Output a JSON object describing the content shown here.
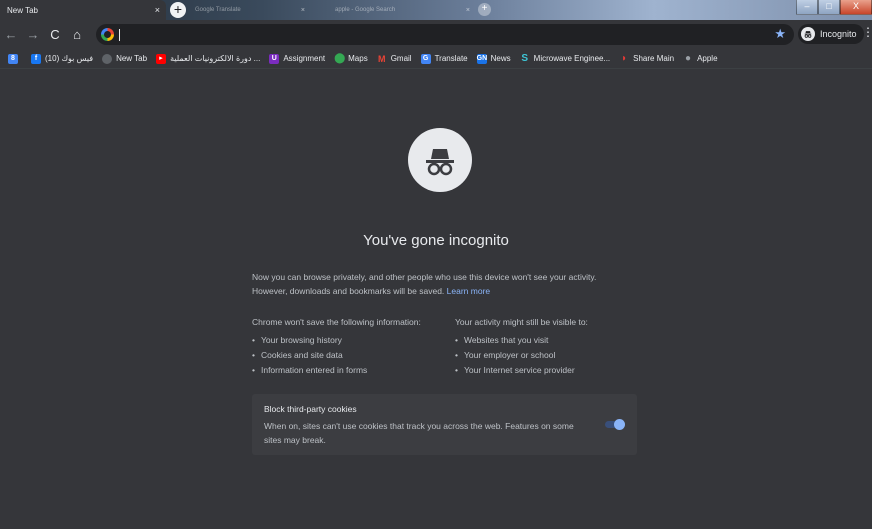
{
  "tabs": {
    "active_title": "New Tab",
    "close_glyph": "×",
    "background": [
      {
        "title": "Google Translate"
      },
      {
        "title": "apple - Google Search"
      }
    ],
    "new_tab_glyph": "+"
  },
  "window_controls": {
    "minimize": "‒",
    "maximize": "□",
    "close": "X"
  },
  "toolbar": {
    "back": "←",
    "forward": "→",
    "reload": "C",
    "home": "⌂",
    "star": "★",
    "incognito_label": "Incognito",
    "menu": "⋮"
  },
  "bookmarks": [
    {
      "label": "",
      "icon": "apps-icon",
      "color": "#4285f4"
    },
    {
      "label": "(10) فيس بوك",
      "icon": "facebook-icon",
      "color": "#1877f2"
    },
    {
      "label": "New Tab",
      "icon": "chrome-icon",
      "color": "#5f6368"
    },
    {
      "label": "دورة الالكترونيات العملية ...",
      "icon": "youtube-icon",
      "color": "#ff0000"
    },
    {
      "label": "Assignment",
      "icon": "u-icon",
      "color": "#7b2cbf"
    },
    {
      "label": "Maps",
      "icon": "maps-icon",
      "color": "#34a853"
    },
    {
      "label": "Gmail",
      "icon": "gmail-icon",
      "color": "#ea4335"
    },
    {
      "label": "Translate",
      "icon": "translate-icon",
      "color": "#4285f4"
    },
    {
      "label": "News",
      "icon": "news-icon",
      "color": "#1a73e8"
    },
    {
      "label": "Microwave Enginee...",
      "icon": "scribd-icon",
      "color": "#1e7b85"
    },
    {
      "label": "Share Main",
      "icon": "share-icon",
      "color": "#e53935"
    },
    {
      "label": "Apple",
      "icon": "apple-icon",
      "color": "#9aa0a6"
    }
  ],
  "page": {
    "headline": "You've gone incognito",
    "intro": "Now you can browse privately, and other people who use this device won't see your activity. However, downloads and bookmarks will be saved.",
    "learn_more": "Learn more",
    "left_heading": "Chrome won't save the following information:",
    "left_items": [
      "Your browsing history",
      "Cookies and site data",
      "Information entered in forms"
    ],
    "right_heading": "Your activity might still be visible to:",
    "right_items": [
      "Websites that you visit",
      "Your employer or school",
      "Your Internet service provider"
    ],
    "cookies_title": "Block third-party cookies",
    "cookies_body": "When on, sites can't use cookies that track you across the web. Features on some sites may break.",
    "cookies_enabled": true
  }
}
